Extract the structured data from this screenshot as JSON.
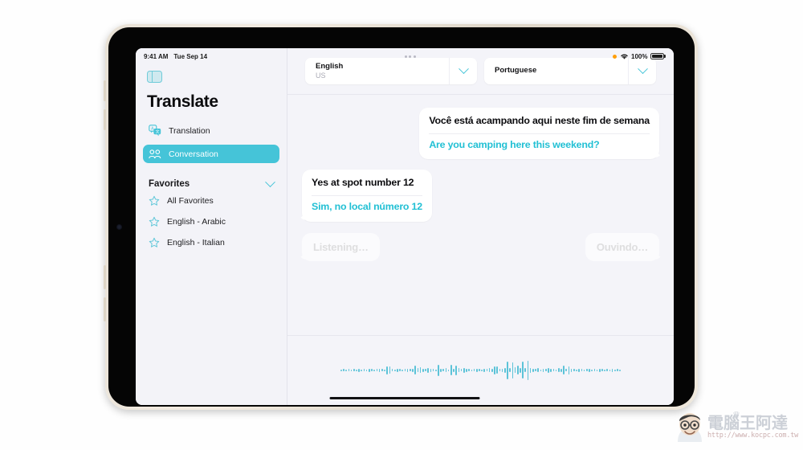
{
  "status_bar": {
    "time": "9:41 AM",
    "date": "Tue Sep 14",
    "battery_percent": "100%",
    "mic_indicator": "orange-dot",
    "wifi_icon": "wifi-icon",
    "battery_icon": "battery-icon",
    "multitask_icon": "three-dots-icon"
  },
  "sidebar": {
    "toggle_icon": "sidebar-toggle-icon",
    "app_title": "Translate",
    "nav": [
      {
        "label": "Translation",
        "icon": "translation-bubbles-icon",
        "selected": false
      },
      {
        "label": "Conversation",
        "icon": "two-people-icon",
        "selected": true
      }
    ],
    "favorites": {
      "header": "Favorites",
      "chevron_icon": "chevron-down-icon",
      "items": [
        {
          "label": "All Favorites",
          "icon": "star-outline-icon"
        },
        {
          "label": "English - Arabic",
          "icon": "star-outline-icon"
        },
        {
          "label": "English - Italian",
          "icon": "star-outline-icon"
        }
      ]
    }
  },
  "language_bar": {
    "source": {
      "name": "English",
      "region": "US",
      "chevron_icon": "chevron-down-icon"
    },
    "target": {
      "name": "Portuguese",
      "region": "",
      "chevron_icon": "chevron-down-icon"
    }
  },
  "conversation": {
    "messages": [
      {
        "side": "right",
        "source_text": "Você está acampando aqui neste fim de semana",
        "translated_text": "Are you camping here this weekend?"
      },
      {
        "side": "left",
        "source_text": "Yes at spot number 12",
        "translated_text": "Sim, no local número 12"
      }
    ],
    "listening_left": "Listening…",
    "listening_right": "Ouvindo…"
  },
  "waveform": {
    "icon": "audio-waveform",
    "color": "#5cc3d8",
    "bars": [
      2,
      3,
      2,
      3,
      2,
      3,
      2,
      4,
      2,
      3,
      2,
      4,
      3,
      2,
      3,
      4,
      3,
      2,
      10,
      9,
      3,
      2,
      4,
      3,
      2,
      3,
      4,
      3,
      4,
      11,
      5,
      7,
      4,
      3,
      6,
      4,
      3,
      2,
      14,
      4,
      3,
      5,
      2,
      13,
      4,
      12,
      5,
      3,
      6,
      4,
      3,
      2,
      3,
      4,
      3,
      2,
      4,
      3,
      5,
      4,
      10,
      9,
      3,
      4,
      6,
      22,
      5,
      20,
      7,
      11,
      6,
      21,
      5,
      24,
      6,
      4,
      3,
      5,
      2,
      4,
      3,
      6,
      4,
      3,
      2,
      5,
      4,
      11,
      3,
      10,
      4,
      3,
      2,
      4,
      3,
      2,
      3,
      4,
      2,
      3,
      2,
      4,
      3,
      2,
      3,
      2,
      4,
      2,
      3,
      2
    ]
  },
  "home_indicator": "home-indicator",
  "watermark": {
    "chinese_title": "電腦王阿達",
    "url": "http://www.kocpc.com.tw",
    "crown_icon": "crown-icon",
    "face_icon": "cartoon-face-icon"
  },
  "colors": {
    "accent_teal": "#45c4d8",
    "translation_teal": "#22c0d4",
    "screen_bg": "#f4f4f9",
    "sidebar_bg": "#f3f3f8",
    "bubble_bg": "#ffffff",
    "ghost_text": "#dededf"
  }
}
